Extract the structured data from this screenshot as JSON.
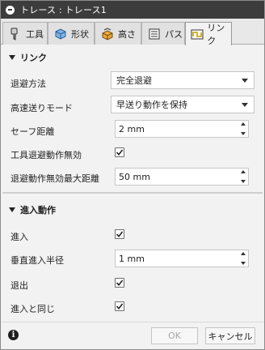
{
  "window": {
    "title": "トレース : トレース1"
  },
  "tabs": [
    {
      "label": "工具",
      "icon": "tool-icon"
    },
    {
      "label": "形状",
      "icon": "geometry-icon"
    },
    {
      "label": "高さ",
      "icon": "heights-icon"
    },
    {
      "label": "パス",
      "icon": "passes-icon"
    },
    {
      "label": "リンク",
      "icon": "linking-icon",
      "active": true
    }
  ],
  "linking": {
    "header": "リンク",
    "retraction_policy": {
      "label": "退避方法",
      "value": "完全退避"
    },
    "high_feed_mode": {
      "label": "高速送りモード",
      "value": "早送り動作を保持"
    },
    "safe_distance": {
      "label": "セーフ距離",
      "value": "2 mm"
    },
    "no_tool_retraction": {
      "label": "工具退避動作無効",
      "checked": true
    },
    "max_stay_down_distance": {
      "label": "退避動作無効最大距離",
      "value": "50 mm"
    }
  },
  "leads": {
    "header": "進入動作",
    "lead_in": {
      "label": "進入",
      "checked": true
    },
    "vertical_lead_in_radius": {
      "label": "垂直進入半径",
      "value": "1 mm"
    },
    "lead_out": {
      "label": "退出",
      "checked": true
    },
    "same_as_lead_in": {
      "label": "進入と同じ",
      "checked": true
    }
  },
  "footer": {
    "ok_label": "OK",
    "cancel_label": "キャンセル"
  },
  "colors": {
    "titlebar": "#3c3c3c",
    "panel": "#f2f2f2"
  }
}
